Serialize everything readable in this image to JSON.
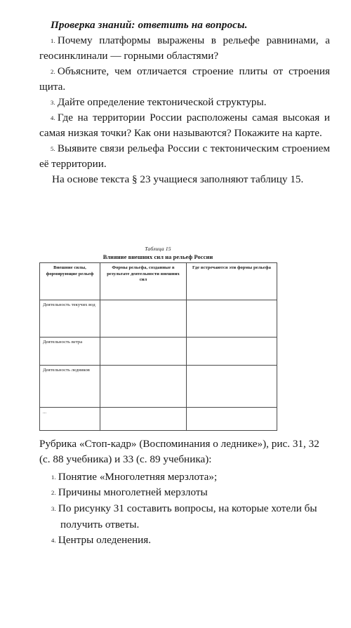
{
  "document": {
    "section_title": "Проверка знаний: ответить на вопросы.",
    "questions": [
      {
        "num": "1.",
        "text": "Почему платформы выражены в рельефе равнинами, а геосинклинали — горными областями?"
      },
      {
        "num": "2.",
        "text": "Объясните, чем отличается строение плиты от строения щита."
      },
      {
        "num": "3.",
        "text": "Дайте определение тектонической структуры."
      },
      {
        "num": "4.",
        "text": "Где на территории России расположены самая высокая и самая низкая точки? Как они называются? Покажите на карте."
      },
      {
        "num": "5.",
        "text": "Выявите связи рельефа России с тектоническим строением её территории."
      }
    ],
    "note_paragraph": "На основе текста § 23 учащиеся заполняют таблицу 15.",
    "table": {
      "caption": "Таблица 15",
      "title": "Влияние внешних сил на рельеф России",
      "headers": [
        "Внешние силы, формирующие рельеф",
        "Формы рельефа, созданные в результате деятельности внешних сил",
        "Где встречаются эти формы рельефа"
      ],
      "rows": [
        {
          "label": "Деятельность текучих вод",
          "forms": "",
          "where": ""
        },
        {
          "label": "Деятельность ветра",
          "forms": "",
          "where": ""
        },
        {
          "label": "Деятельность ледников",
          "forms": "",
          "where": ""
        },
        {
          "label": "...",
          "forms": "",
          "where": ""
        }
      ]
    },
    "bottom_paragraph": "Рубрика «Стоп-кадр» (Воспоминания о леднике»), рис. 31, 32 (с. 88 учебника) и 33 (с. 89 учебника):",
    "bottom_items": [
      {
        "num": "1.",
        "text": "Понятие «Многолетняя мерзлота»;"
      },
      {
        "num": "2.",
        "text": "Причины многолетней мерзлоты"
      },
      {
        "num": "3.",
        "text": "По рисунку 31 составить вопросы, на которые хотели бы получить ответы."
      },
      {
        "num": "4.",
        "text": "Центры оледенения."
      }
    ]
  }
}
